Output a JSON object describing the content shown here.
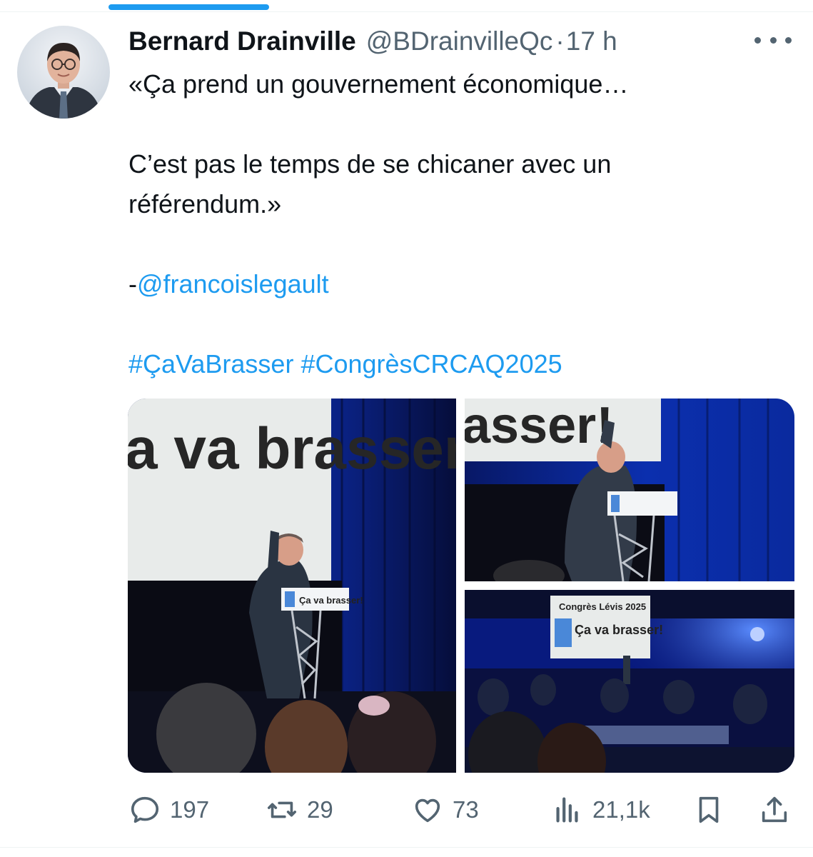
{
  "tweet": {
    "author": {
      "display_name": "Bernard Drainville",
      "handle": "@BDrainvilleQc",
      "separator": "·",
      "time": "17 h"
    },
    "text": {
      "line1": "«Ça prend un gouvernement économique…",
      "line2": "C’est pas le temps de se chicaner avec un référendum.»",
      "attribution_prefix": "-",
      "mention": "@francoislegault",
      "hashtag1": "#ÇaVaBrasser",
      "hashtag2": "#CongrèsCRCAQ2025"
    },
    "media": {
      "photo1_sign": "a va brasser!",
      "photo2_sign": "asser!",
      "photo3_sign_small": "Congrès Lévis 2025",
      "photo3_sign_big": "Ça va brasser!",
      "podium_text": "Ça va brasser!"
    }
  },
  "actions": {
    "replies": {
      "icon": "reply-icon",
      "count": "197"
    },
    "reposts": {
      "icon": "repost-icon",
      "count": "29"
    },
    "likes": {
      "icon": "heart-icon",
      "count": "73"
    },
    "views": {
      "icon": "analytics-icon",
      "count": "21,1k"
    },
    "bookmark": {
      "icon": "bookmark-icon"
    },
    "share": {
      "icon": "share-icon"
    }
  },
  "colors": {
    "accent": "#1d9bf0",
    "text": "#0f1419",
    "secondary": "#536471",
    "stage_blue": "#0a2a9e"
  }
}
